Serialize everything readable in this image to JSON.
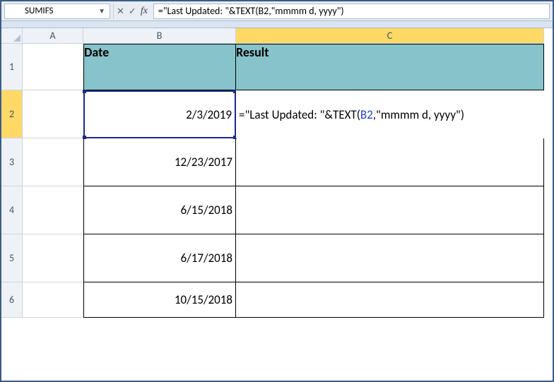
{
  "formula_bar": {
    "name_box": "SUMIFS",
    "fx_label": "fx",
    "cancel": "✕",
    "confirm": "✓",
    "formula_prefix": "=\"Last Updated: \"&TEXT(",
    "formula_ref": "B2",
    "formula_suffix": ",\"mmmm d, yyyy\")"
  },
  "columns": {
    "A": "A",
    "B": "B",
    "C": "C"
  },
  "rows": {
    "1": "1",
    "2": "2",
    "3": "3",
    "4": "4",
    "5": "5",
    "6": "6"
  },
  "headers": {
    "date": "Date",
    "result": "Result"
  },
  "data": {
    "B2": "2/3/2019",
    "B3": "12/23/2017",
    "B4": "6/15/2018",
    "B5": "6/17/2018",
    "B6": "10/15/2018"
  },
  "edit": {
    "prefix": "=\"Last Updated: \"&TEXT(",
    "ref": "B2",
    "suffix": ",\"mmmm d, yyyy\")"
  }
}
